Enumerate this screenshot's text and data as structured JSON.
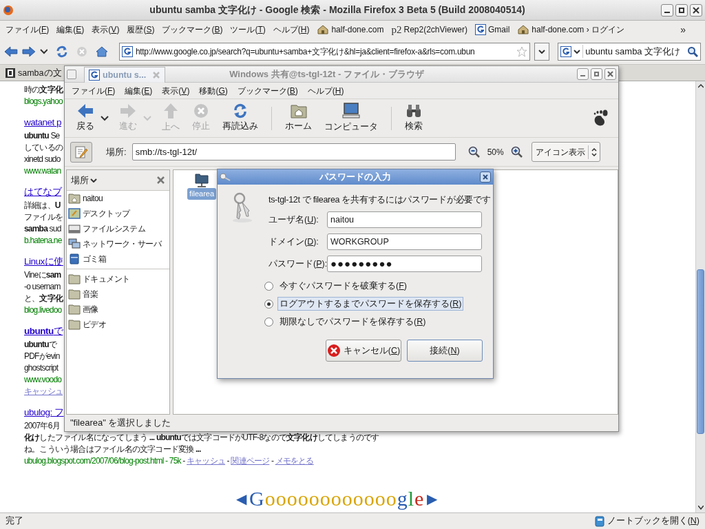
{
  "firefox": {
    "title": "ubuntu samba 文字化け - Google 検索 - Mozilla Firefox 3 Beta 5 (Build 2008040514)",
    "menu": [
      "ファイル(F)",
      "編集(E)",
      "表示(V)",
      "履歴(S)",
      "ブックマーク(B)",
      "ツール(T)",
      "ヘルプ(H)"
    ],
    "bookmarks": [
      {
        "label": "half-done.com"
      },
      {
        "label": "Rep2(2chViewer)",
        "icon_text": "p2"
      },
      {
        "label": "Gmail"
      },
      {
        "label": "half-done.com › ログイン"
      }
    ],
    "chevron": "»",
    "url": "http://www.google.co.jp/search?q=ubuntu+samba+文字化け&hl=ja&client=firefox-a&rls=com.ubun",
    "search": "ubuntu samba 文字化け",
    "tabs": [
      {
        "label": "sambaの文",
        "selected": false
      },
      {
        "label": "ubuntu s...",
        "selected": true
      }
    ],
    "status": "完了",
    "notebook": "ノートブックを開く(N)"
  },
  "results": [
    {
      "snippet": [
        "時の**文字化**"
      ],
      "meta": [
        [
          {
            "kind": "url",
            "text": "blogs.yahoo"
          }
        ]
      ]
    },
    {
      "title": "watanet p",
      "snippet": [
        "**ubuntu** Se",
        "しているの",
        "xinetd sudo"
      ],
      "meta": [
        [
          {
            "kind": "url",
            "text": "www.watan"
          }
        ]
      ]
    },
    {
      "title": "はてなブ",
      "snippet": [
        "詳細は、**U**",
        "ファイルを",
        "**samba** sud"
      ],
      "meta": [
        [
          {
            "kind": "url",
            "text": "b.hatena.ne"
          }
        ]
      ]
    },
    {
      "title": "Linuxに使",
      "snippet": [
        "Vineに**sam**",
        "-o usernam",
        "と、**文字化**"
      ],
      "meta": [
        [
          {
            "kind": "url",
            "text": "blog.livedoo"
          }
        ]
      ]
    },
    {
      "title": "**ubuntu**で",
      "snippet": [
        "**ubuntu**で",
        "PDFがevin",
        "ghostscript"
      ],
      "meta": [
        [
          {
            "kind": "url",
            "text": "www.voodo"
          }
        ],
        [
          {
            "kind": "link",
            "text": "キャッシュ"
          }
        ]
      ]
    },
    {
      "title": "ubulog: フ",
      "snippet": [
        "2007年6月",
        "**化け**したファイル名になってしまう **...** **ubuntu**では文字コードがUTF-8なので**文字化け**してしまうのです",
        "ね。こういう場合はファイル名の文字コード変換 **...**"
      ],
      "meta": [
        [
          {
            "kind": "url",
            "text": "ubulog.blogspot.com/2007/06/blog-post.html - 75k"
          },
          {
            "kind": "sep",
            "text": " - "
          },
          {
            "kind": "link",
            "text": "キャッシュ"
          },
          {
            "kind": "sep",
            "text": " - "
          },
          {
            "kind": "link",
            "text": "関連ページ"
          },
          {
            "kind": "sep",
            "text": " - "
          },
          {
            "kind": "link",
            "text": "メモをとる"
          }
        ]
      ]
    }
  ],
  "pager": {
    "prev": "◀",
    "logo": "Goooooooooooogle",
    "next": "▶"
  },
  "file_browser": {
    "title": "Windows 共有@ts-tgl-12t - ファイル・ブラウザ",
    "menu": [
      "ファイル(F)",
      "編集(E)",
      "表示(V)",
      "移動(G)",
      "ブックマーク(B)",
      "ヘルプ(H)"
    ],
    "toolbar": [
      {
        "kind": "button",
        "label": "戻る",
        "disabled": false,
        "dropdown": true
      },
      {
        "kind": "button",
        "label": "進む",
        "disabled": true,
        "dropdown": true
      },
      {
        "kind": "button",
        "label": "上へ",
        "disabled": true
      },
      {
        "kind": "button",
        "label": "停止",
        "disabled": true
      },
      {
        "kind": "button",
        "label": "再読込み",
        "disabled": false
      },
      {
        "kind": "separator"
      },
      {
        "kind": "button",
        "label": "ホーム",
        "disabled": false
      },
      {
        "kind": "button",
        "label": "コンピュータ",
        "disabled": false
      },
      {
        "kind": "separator"
      },
      {
        "kind": "button",
        "label": "検索",
        "disabled": false
      }
    ],
    "location_label": "場所:",
    "location": "smb://ts-tgl-12t/",
    "zoom": "50%",
    "view": "アイコン表示",
    "sidebar": {
      "header": "場所",
      "places": [
        {
          "label": "naitou"
        },
        {
          "label": "デスクトップ"
        },
        {
          "label": "ファイルシステム"
        },
        {
          "label": "ネットワーク・サーバ"
        },
        {
          "label": "ゴミ箱"
        }
      ],
      "bookmarks": [
        {
          "label": "ドキュメント"
        },
        {
          "label": "音楽"
        },
        {
          "label": "画像"
        },
        {
          "label": "ビデオ"
        }
      ]
    },
    "items": [
      {
        "label": "filearea",
        "selected": true
      }
    ],
    "status": "\"filearea\" を選択しました"
  },
  "dialog": {
    "title": "パスワードの入力",
    "message": "ts-tgl-12t で filearea を共有するにはパスワードが必要です",
    "fields": [
      {
        "label": "ユーザ名(U):",
        "value": "naitou",
        "kind": "text"
      },
      {
        "label": "ドメイン(D):",
        "value": "WORKGROUP",
        "kind": "text"
      },
      {
        "label": "パスワード(P):",
        "value": "●●●●●●●●●",
        "kind": "password"
      }
    ],
    "options": [
      {
        "label": "今すぐパスワードを破棄する(F)",
        "selected": false,
        "focused": false
      },
      {
        "label": "ログアウトするまでパスワードを保存する(R)",
        "selected": true,
        "focused": true
      },
      {
        "label": "期限なしでパスワードを保存する(R)",
        "selected": false,
        "focused": false
      }
    ],
    "buttons": [
      {
        "label": "キャンセル(C)",
        "kind": "cancel"
      },
      {
        "label": "接続(N)",
        "kind": "default"
      }
    ]
  }
}
